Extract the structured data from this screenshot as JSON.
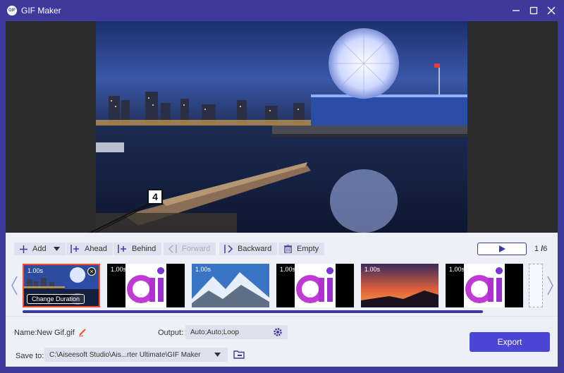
{
  "window": {
    "title": "GIF Maker",
    "logo_text": "GIF"
  },
  "callout": {
    "number": "4"
  },
  "toolbar": {
    "add": "Add",
    "ahead": "Ahead",
    "behind": "Behind",
    "forward": "Forward",
    "backward": "Backward",
    "empty": "Empty",
    "page_current": "1",
    "page_total": "6"
  },
  "timeline": {
    "frames": [
      {
        "duration": "1.00s",
        "image": "city-night",
        "selected": true,
        "change_label": "Change Duration"
      },
      {
        "duration": "1.00s",
        "image": "ai-logo"
      },
      {
        "duration": "1.00s",
        "image": "mountains"
      },
      {
        "duration": "1.00s",
        "image": "ai-logo"
      },
      {
        "duration": "1.00s",
        "image": "sunset"
      },
      {
        "duration": "1.00s",
        "image": "ai-logo"
      }
    ]
  },
  "output": {
    "name_label": "Name:",
    "name_value": "New Gif.gif",
    "output_label": "Output:",
    "output_value": "Auto;Auto;Loop",
    "save_label": "Save to:",
    "save_path": "C:\\Aiseesoft Studio\\Ais...rter Ultimate\\GIF Maker",
    "export_label": "Export"
  },
  "colors": {
    "brand": "#3e3a9b",
    "accent": "#4b46d6",
    "selected_frame": "#ff4a2b"
  }
}
